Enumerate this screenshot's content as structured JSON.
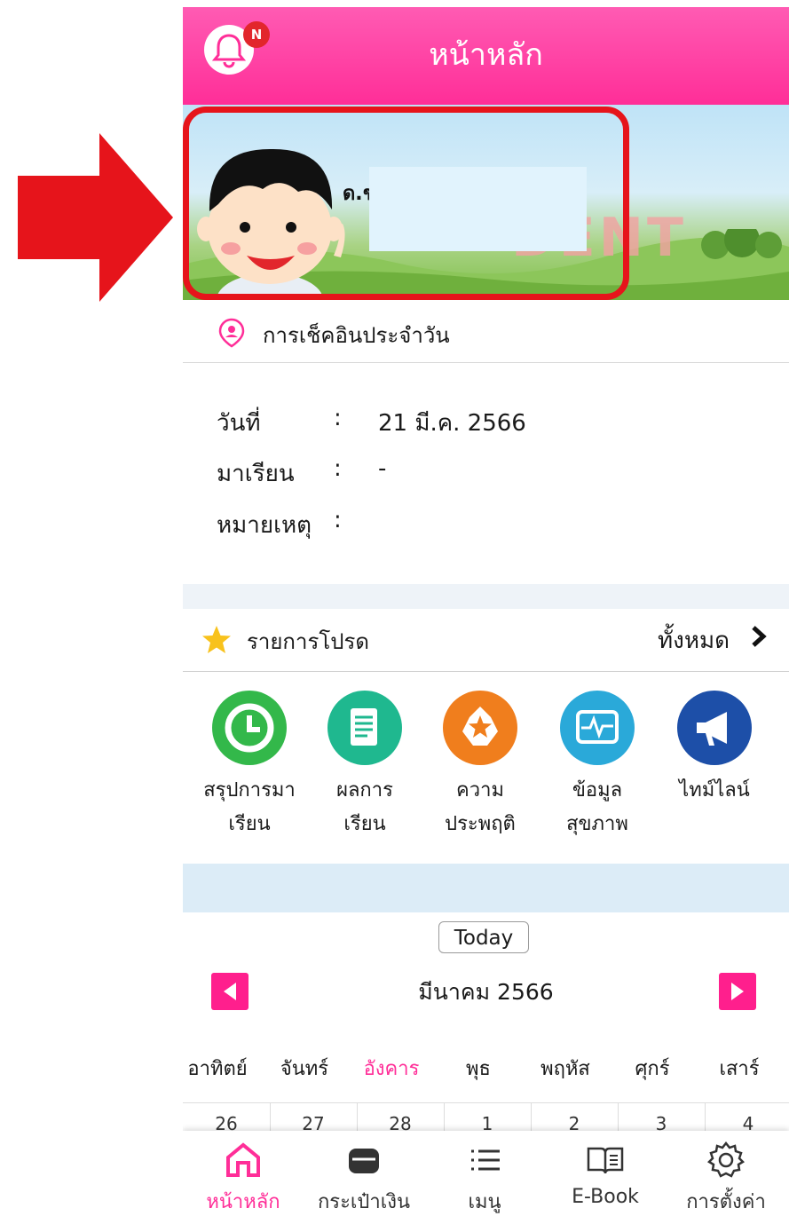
{
  "appbar": {
    "title": "หน้าหลัก",
    "badge": "N"
  },
  "banner": {
    "student_prefix": "ด.ช."
  },
  "checkin": {
    "title": "การเช็คอินประจำวัน",
    "rows": [
      {
        "label": "วันที่",
        "colon": ":",
        "value": "21 มี.ค. 2566"
      },
      {
        "label": "มาเรียน",
        "colon": ":",
        "value": "-"
      },
      {
        "label": "หมายเหตุ",
        "colon": ":",
        "value": ""
      }
    ]
  },
  "favorites": {
    "title": "รายการโปรด",
    "all_label": "ทั้งหมด",
    "items": [
      {
        "line1": "สรุปการมา",
        "line2": "เรียน",
        "color": "#33b84a",
        "icon": "clock-icon"
      },
      {
        "line1": "ผลการ",
        "line2": "เรียน",
        "color": "#1fb88f",
        "icon": "document-icon"
      },
      {
        "line1": "ความ",
        "line2": "ประพฤติ",
        "color": "#f07e1d",
        "icon": "star-badge-icon"
      },
      {
        "line1": "ข้อมูล",
        "line2": "สุขภาพ",
        "color": "#2aa9d9",
        "icon": "heartbeat-monitor-icon"
      },
      {
        "line1": "ไทม์ไลน์",
        "line2": "",
        "color": "#1d4fa8",
        "icon": "megaphone-icon"
      }
    ]
  },
  "calendar": {
    "today_label": "Today",
    "month_label": "มีนาคม 2566",
    "weekdays": [
      "อาทิตย์",
      "จันทร์",
      "อังคาร",
      "พุธ",
      "พฤหัส",
      "ศุกร์",
      "เสาร์"
    ],
    "days": [
      "26",
      "27",
      "28",
      "1",
      "2",
      "3",
      "4"
    ]
  },
  "bottom_nav": [
    {
      "label": "หน้าหลัก",
      "icon": "home-icon"
    },
    {
      "label": "กระเป๋าเงิน",
      "icon": "wallet-icon"
    },
    {
      "label": "เมนู",
      "icon": "menu-list-icon"
    },
    {
      "label": "E-Book",
      "icon": "book-icon"
    },
    {
      "label": "การตั้งค่า",
      "icon": "gear-icon"
    }
  ],
  "colors": {
    "accent": "#ff2e98",
    "highlight": "#e6141b"
  }
}
